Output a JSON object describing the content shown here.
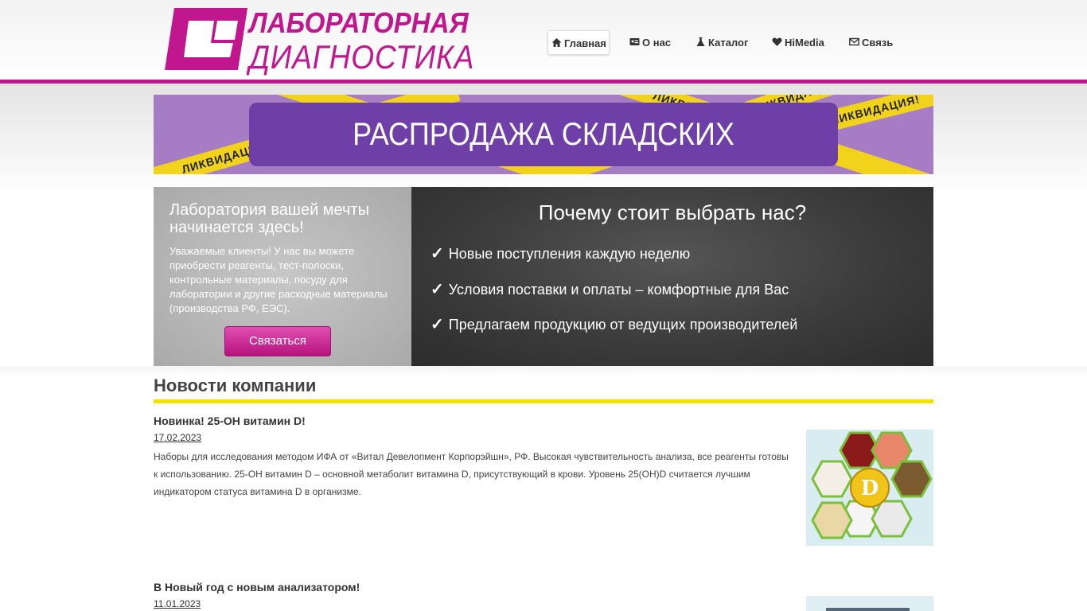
{
  "logo": {
    "line1": "ЛАБОРАТОРНАЯ",
    "line2": "ДИАГНОСТИКА",
    "color": "#c0168e"
  },
  "nav": {
    "items": [
      {
        "label": "Главная",
        "icon": "home-icon",
        "active": true
      },
      {
        "label": "О нас",
        "icon": "id-card-icon",
        "active": false
      },
      {
        "label": "Каталог",
        "icon": "flask-icon",
        "active": false
      },
      {
        "label": "HiMedia",
        "icon": "heart-icon",
        "active": false
      },
      {
        "label": "Связь",
        "icon": "envelope-icon",
        "active": false
      }
    ]
  },
  "sale_banner": {
    "text": "РАСПРОДАЖА СКЛАДСКИХ ЗАПАСОВ!",
    "tape_text": "ЛИКВИДАЦИЯ!"
  },
  "promo": {
    "title": "Лаборатория вашей мечты начинается здесь!",
    "text": "Уважаемые клиенты! У нас вы можете приобрести реагенты, тест-полоски, контрольные материалы, посуду для лаборатории и другие расходные материалы (производства РФ, ЕЭС).",
    "button": "Связаться"
  },
  "why": {
    "title": "Почему стоит выбрать нас?",
    "items": [
      "Новые поступления каждую неделю",
      "Условия поставки и оплаты – комфортные для Вас",
      "Предлагаем продукцию от ведущих производителей"
    ]
  },
  "news": {
    "title": "Новости компании",
    "items": [
      {
        "title": "Новинка! 25-OH витамин D!",
        "date": "17.02.2023",
        "text": "Наборы для исследования методом ИФА от «Витал Девелопмент Корпорэйшн», РФ. Высокая чувствительность анализа, все реагенты готовы к использованию. 25-ОН витамин D – основной метаболит витамина D, присутствующий в крови. Уровень 25(OH)D считается лучшим индикатором статуса витамина D в организме.",
        "image_label": "D"
      },
      {
        "title": "В Новый год с новым анализатором!",
        "date": "11.01.2023"
      }
    ]
  }
}
